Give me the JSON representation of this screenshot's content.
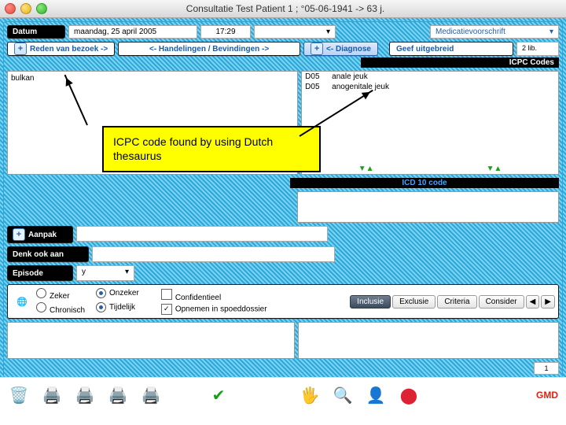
{
  "window_title": "Consultatie   Test Patient 1 ; °05-06-1941 -> 63 j.",
  "topbar": {
    "datum_label": "Datum",
    "date_value": "maandag, 25 april 2005",
    "time_value": "17:29",
    "med_label": "Medicatievoorschrift"
  },
  "tabs": {
    "reden": "Reden van bezoek ->",
    "handel": "<- Handelingen / Bevindingen ->",
    "diagnose": "<- Diagnose",
    "geef": "Geef uitgebreid",
    "icpc_header": "ICPC Codes",
    "count": "2 lib."
  },
  "left": {
    "entry": "bulkan"
  },
  "callout_text": "ICPC code found by using Dutch thesaurus",
  "right": {
    "rows": [
      {
        "code": "D05",
        "label": "anale jeuk"
      },
      {
        "code": "D05",
        "label": "anogenitale jeuk"
      }
    ],
    "icd_header": "ICD 10 code"
  },
  "middle": {
    "aanpak": "Aanpak",
    "denk": "Denk ook aan",
    "episode": "Episode",
    "y": "y"
  },
  "options": {
    "zeker": "Zeker",
    "onzeker": "Onzeker",
    "chronisch": "Chronisch",
    "tijdelijk": "Tijdelijk",
    "conf": "Confidentieel",
    "spoed": "Opnemen in spoeddossier"
  },
  "bottom_tabs": {
    "inclusie": "Inclusie",
    "exclusie": "Exclusie",
    "criteria": "Criteria",
    "consider": "Consider"
  },
  "footer": {
    "gmd": "GMD",
    "page": "1"
  }
}
